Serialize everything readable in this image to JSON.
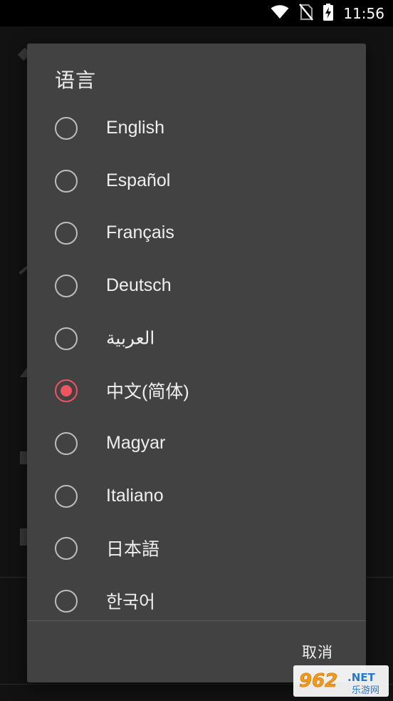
{
  "status_bar": {
    "time": "11:56",
    "icons": [
      "wifi-icon",
      "no-sim-icon",
      "battery-charging-icon"
    ]
  },
  "dialog": {
    "title": "语言",
    "options": [
      {
        "label": "English",
        "selected": false
      },
      {
        "label": "Español",
        "selected": false
      },
      {
        "label": "Français",
        "selected": false
      },
      {
        "label": "Deutsch",
        "selected": false
      },
      {
        "label": "العربية",
        "selected": false
      },
      {
        "label": "中文(简体)",
        "selected": true
      },
      {
        "label": "Magyar",
        "selected": false
      },
      {
        "label": "Italiano",
        "selected": false
      },
      {
        "label": "日本語",
        "selected": false
      },
      {
        "label": "한국어",
        "selected": false
      }
    ],
    "cancel_label": "取消"
  },
  "colors": {
    "accent": "#ef5461",
    "dialog_bg": "#424242",
    "backdrop": "#121212"
  },
  "watermark": {
    "number": "962",
    "suffix": ".NET",
    "subtitle": "乐游网"
  }
}
